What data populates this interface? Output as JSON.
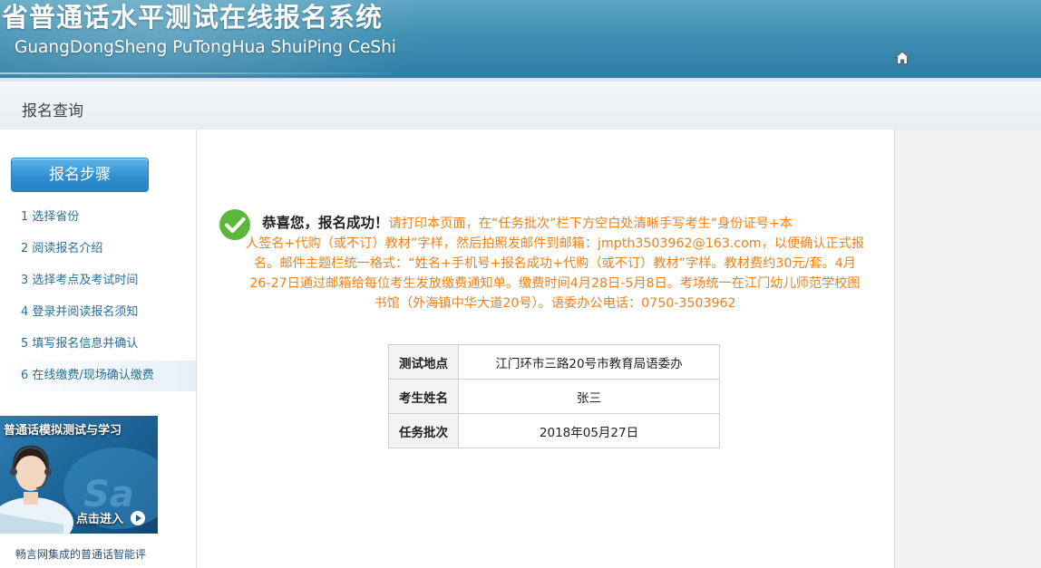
{
  "header": {
    "title_cn": "东省普通话水平测试在线报名系统",
    "title_en": "GuangDongSheng PuTongHua ShuiPing CeShi",
    "home_icon": "home-icon"
  },
  "subbar": {
    "page_title": "报名查询"
  },
  "sidebar": {
    "steps_title": "报名步骤",
    "steps": [
      {
        "label": "1 选择省份"
      },
      {
        "label": "2 阅读报名介绍"
      },
      {
        "label": "3 选择考点及考试时间"
      },
      {
        "label": "4 登录并阅读报名须知"
      },
      {
        "label": "5 填写报名信息并确认"
      },
      {
        "label": "6 在线缴费/现场确认缴费"
      }
    ],
    "ad": {
      "title": "普通话模拟测试与学习",
      "enter": "点击进入",
      "caption": "畅言网集成的普通话智能评"
    }
  },
  "main": {
    "success": {
      "icon": "check-icon",
      "lead": "恭喜您，报名成功！",
      "line1_rest": "请打印本页面，在“任务批次”栏下方空白处清晰手写考生“身份证号+本",
      "line2": "人签名+代购（或不订）教材”字样，然后拍照发邮件到邮箱：jmpth3503962@163.com，以便确认正式报",
      "line3": "名。邮件主题栏统一格式：“姓名+手机号+报名成功+代购（或不订）教材”字样。教材费约30元/套。4月",
      "line4": "26-27日通过邮箱给每位考生发放缴费通知单。缴费时间4月28日-5月8日。考场统一在江门幼儿师范学校图",
      "line5": "书馆（外海镇中华大道20号）。语委办公电话：0750-3503962"
    },
    "table": [
      {
        "label": "测试地点",
        "value": "江门环市三路20号市教育局语委办"
      },
      {
        "label": "考生姓名",
        "value": "张三"
      },
      {
        "label": "任务批次",
        "value": "2018年05月27日"
      }
    ]
  }
}
